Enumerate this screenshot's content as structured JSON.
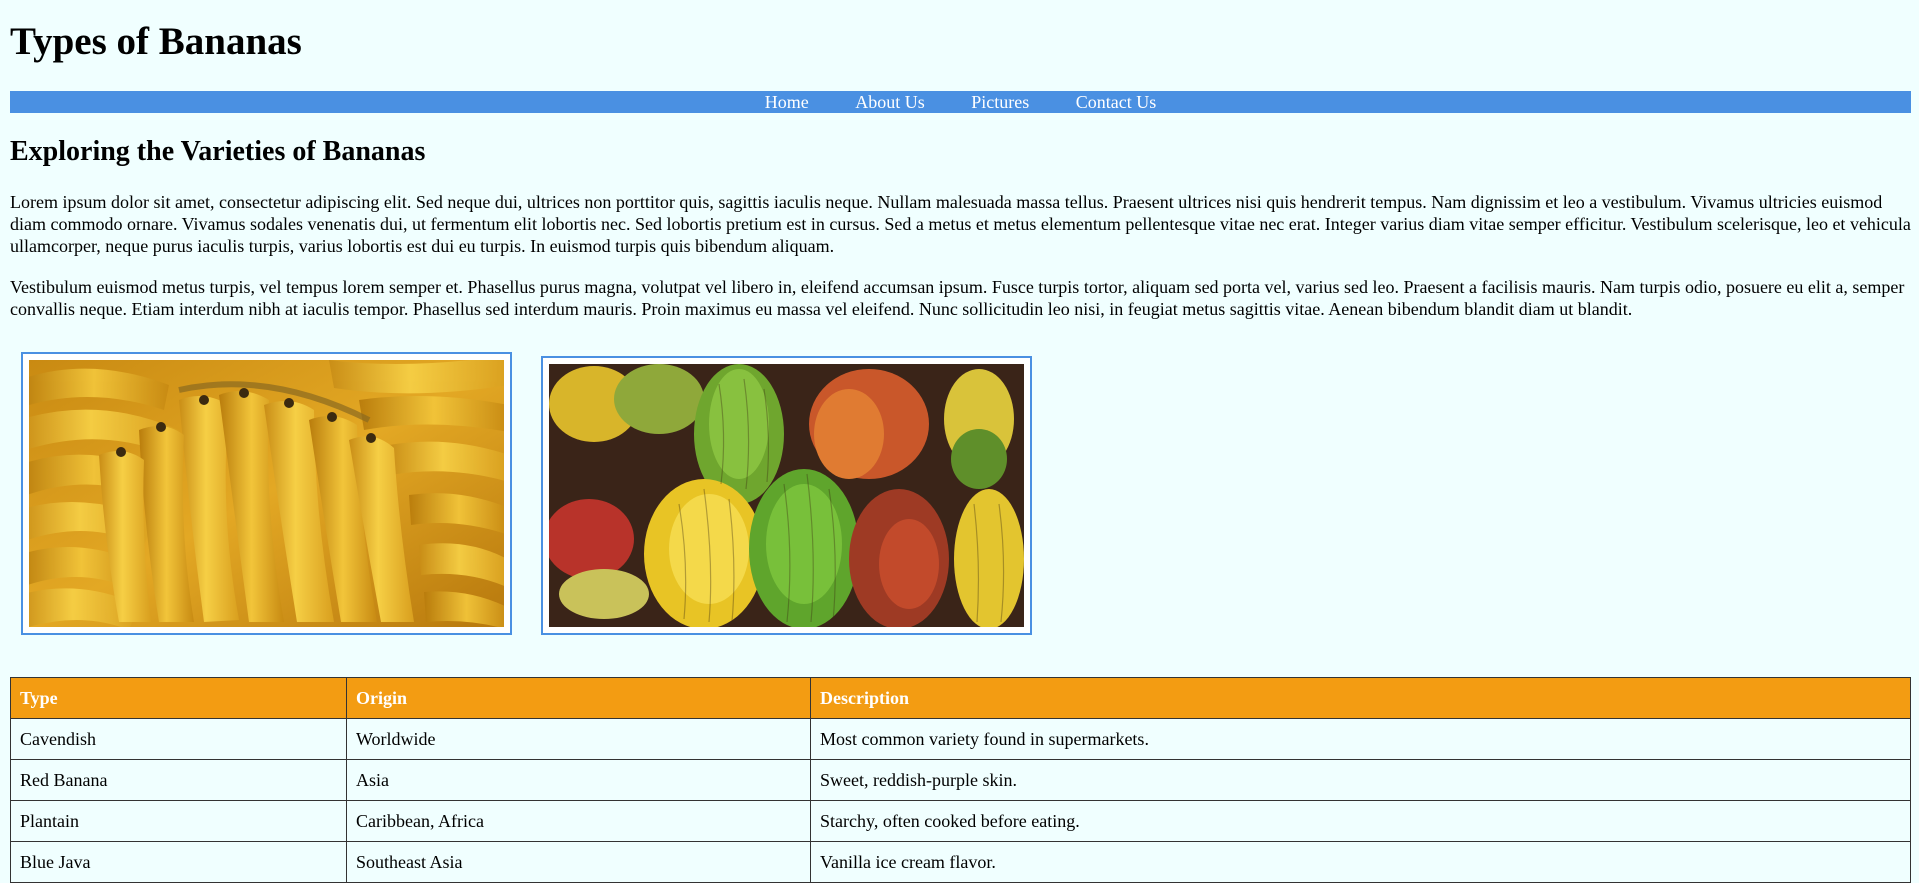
{
  "header": {
    "title": "Types of Bananas"
  },
  "nav": {
    "items": [
      {
        "label": "Home"
      },
      {
        "label": "About Us"
      },
      {
        "label": "Pictures"
      },
      {
        "label": "Contact Us"
      }
    ]
  },
  "main": {
    "heading": "Exploring the Varieties of Bananas",
    "paragraphs": [
      "Lorem ipsum dolor sit amet, consectetur adipiscing elit. Sed neque dui, ultrices non porttitor quis, sagittis iaculis neque. Nullam malesuada massa tellus. Praesent ultrices nisi quis hendrerit tempus. Nam dignissim et leo a vestibulum. Vivamus ultricies euismod diam commodo ornare. Vivamus sodales venenatis dui, ut fermentum elit lobortis nec. Sed lobortis pretium est in cursus. Sed a metus et metus elementum pellentesque vitae nec erat. Integer varius diam vitae semper efficitur. Vestibulum scelerisque, leo et vehicula ullamcorper, neque purus iaculis turpis, varius lobortis est dui eu turpis. In euismod turpis quis bibendum aliquam.",
      "Vestibulum euismod metus turpis, vel tempus lorem semper et. Phasellus purus magna, volutpat vel libero in, eleifend accumsan ipsum. Fusce turpis tortor, aliquam sed porta vel, varius sed leo. Praesent a facilisis mauris. Nam turpis odio, posuere eu elit a, semper convallis neque. Etiam interdum nibh at iaculis tempor. Phasellus sed interdum mauris. Proin maximus eu massa vel eleifend. Nunc sollicitudin leo nisi, in feugiat metus sagittis vitae. Aenean bibendum blandit diam ut blandit."
    ]
  },
  "table": {
    "headers": [
      "Type",
      "Origin",
      "Description"
    ],
    "rows": [
      [
        "Cavendish",
        "Worldwide",
        "Most common variety found in supermarkets."
      ],
      [
        "Red Banana",
        "Asia",
        "Sweet, reddish-purple skin."
      ],
      [
        "Plantain",
        "Caribbean, Africa",
        "Starchy, often cooked before eating."
      ],
      [
        "Blue Java",
        "Southeast Asia",
        "Vanilla ice cream flavor."
      ]
    ]
  },
  "colors": {
    "background": "#f0ffff",
    "nav_bar": "#4a90e2",
    "image_border": "#4a90e2",
    "table_header": "#f39c12"
  }
}
